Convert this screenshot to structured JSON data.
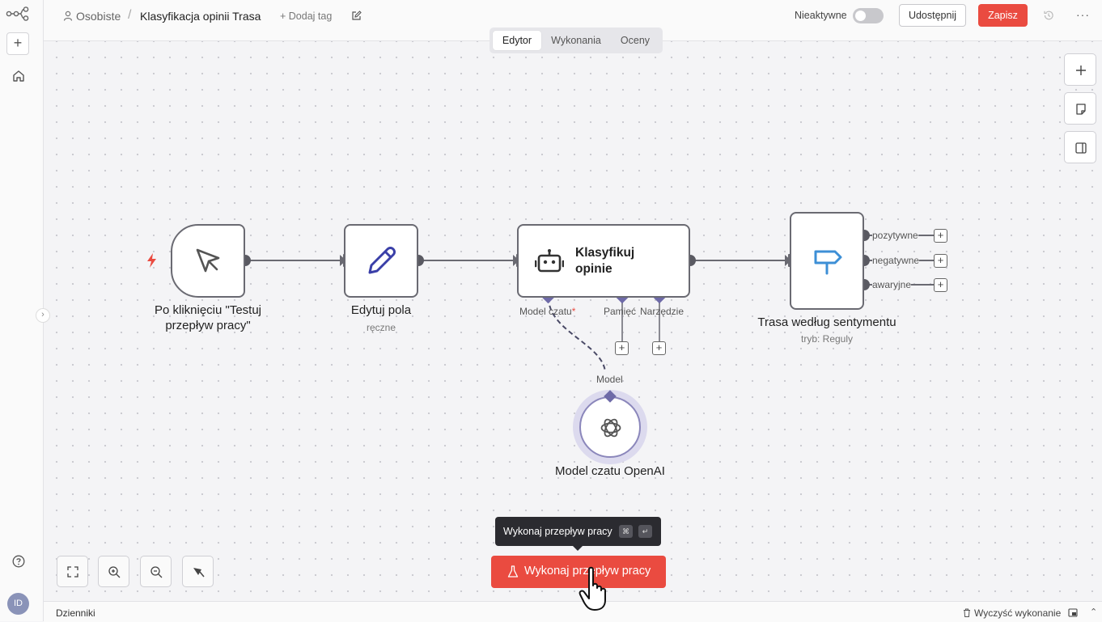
{
  "breadcrumb": {
    "project": "Osobiste",
    "separator": "/",
    "title": "Klasyfikacja opinii Trasa",
    "add_tag": "+ Dodaj tag"
  },
  "header": {
    "inactive_label": "Nieaktywne",
    "share_label": "Udostępnij",
    "save_label": "Zapisz",
    "more": "···"
  },
  "sidebar": {
    "add": "+",
    "avatar_initials": "ID",
    "collapse": "›"
  },
  "tabs": [
    {
      "label": "Edytor",
      "active": true
    },
    {
      "label": "Wykonania"
    },
    {
      "label": "Oceny"
    }
  ],
  "nodes": {
    "trigger": {
      "label": "Po kliknięciu \"Testuj przepływ pracy\""
    },
    "edit_fields": {
      "label": "Edytuj pola",
      "sublabel": "ręczne"
    },
    "classify": {
      "label": "Klasyfikuj opinie",
      "ports": {
        "model": "Model czatu",
        "required": "*",
        "memory": "Pamięć",
        "tool": "Narzędzie"
      }
    },
    "router": {
      "label": "Trasa według sentymentu",
      "sublabel": "tryb: Reguly",
      "outputs": [
        "pozytywne",
        "negatywne",
        "awaryjne"
      ]
    },
    "openai": {
      "label": "Model czatu OpenAI",
      "port_label": "Model"
    }
  },
  "plus": "+",
  "tooltip": {
    "text": "Wykonaj przepływ pracy",
    "key1": "⌘",
    "key2": "↵"
  },
  "run_button": {
    "label": "Wykonaj przepływ pracy"
  },
  "footer": {
    "logs": "Dzienniki",
    "clear": "Wyczyść wykonanie",
    "chevron": "⌃"
  },
  "colors": {
    "accent": "#ea4b40",
    "ai_port": "#6e6aa8",
    "router_icon": "#3d8fd6",
    "trigger_bolt": "#ea4b40",
    "edit_icon": "#3a3fa8"
  }
}
